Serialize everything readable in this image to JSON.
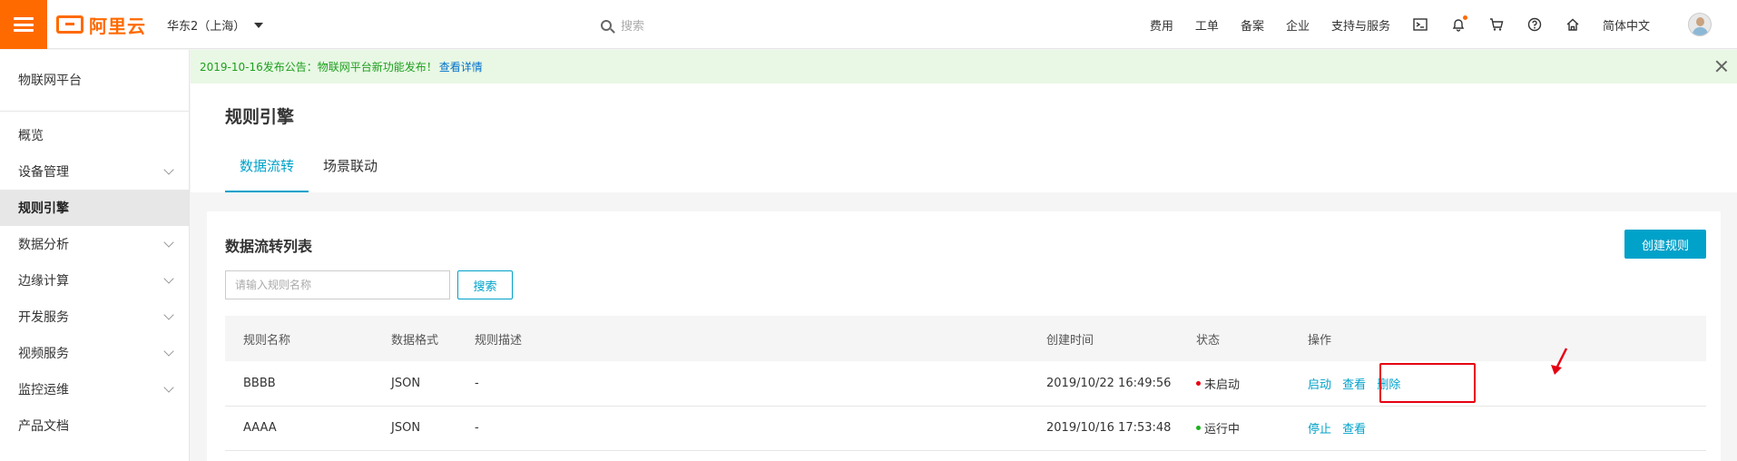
{
  "header": {
    "brand": "阿里云",
    "region": "华东2（上海）",
    "search_placeholder": "搜索",
    "nav": [
      "费用",
      "工单",
      "备案",
      "企业",
      "支持与服务"
    ],
    "language": "简体中文",
    "icons": [
      "terminal-icon",
      "bell-icon",
      "cart-icon",
      "help-icon",
      "home-icon"
    ]
  },
  "sidebar": {
    "title": "物联网平台",
    "items": [
      {
        "label": "概览",
        "expandable": false
      },
      {
        "label": "设备管理",
        "expandable": true
      },
      {
        "label": "规则引擎",
        "expandable": false,
        "active": true
      },
      {
        "label": "数据分析",
        "expandable": true
      },
      {
        "label": "边缘计算",
        "expandable": true
      },
      {
        "label": "开发服务",
        "expandable": true
      },
      {
        "label": "视频服务",
        "expandable": true
      },
      {
        "label": "监控运维",
        "expandable": true
      },
      {
        "label": "产品文档",
        "expandable": false
      }
    ]
  },
  "notice": {
    "text": "2019-10-16发布公告：物联网平台新功能发布！",
    "link": "查看详情"
  },
  "page": {
    "title": "规则引擎",
    "tabs": [
      "数据流转",
      "场景联动"
    ],
    "active_tab": 0
  },
  "card": {
    "title": "数据流转列表",
    "create_button": "创建规则",
    "search_placeholder": "请输入规则名称",
    "search_button": "搜索"
  },
  "table": {
    "columns": [
      "规则名称",
      "数据格式",
      "规则描述",
      "创建时间",
      "状态",
      "操作"
    ],
    "rows": [
      {
        "name": "BBBB",
        "format": "JSON",
        "desc": "-",
        "created": "2019/10/22 16:49:56",
        "status": "未启动",
        "status_color": "#e60012",
        "ops": [
          "启动",
          "查看",
          "删除"
        ]
      },
      {
        "name": "AAAA",
        "format": "JSON",
        "desc": "-",
        "created": "2019/10/16 17:53:48",
        "status": "运行中",
        "status_color": "#1eb11e",
        "ops": [
          "停止",
          "查看"
        ]
      }
    ]
  },
  "colors": {
    "accent": "#00a2ca",
    "brand": "#ff6a00",
    "annotation": "#e60012"
  }
}
